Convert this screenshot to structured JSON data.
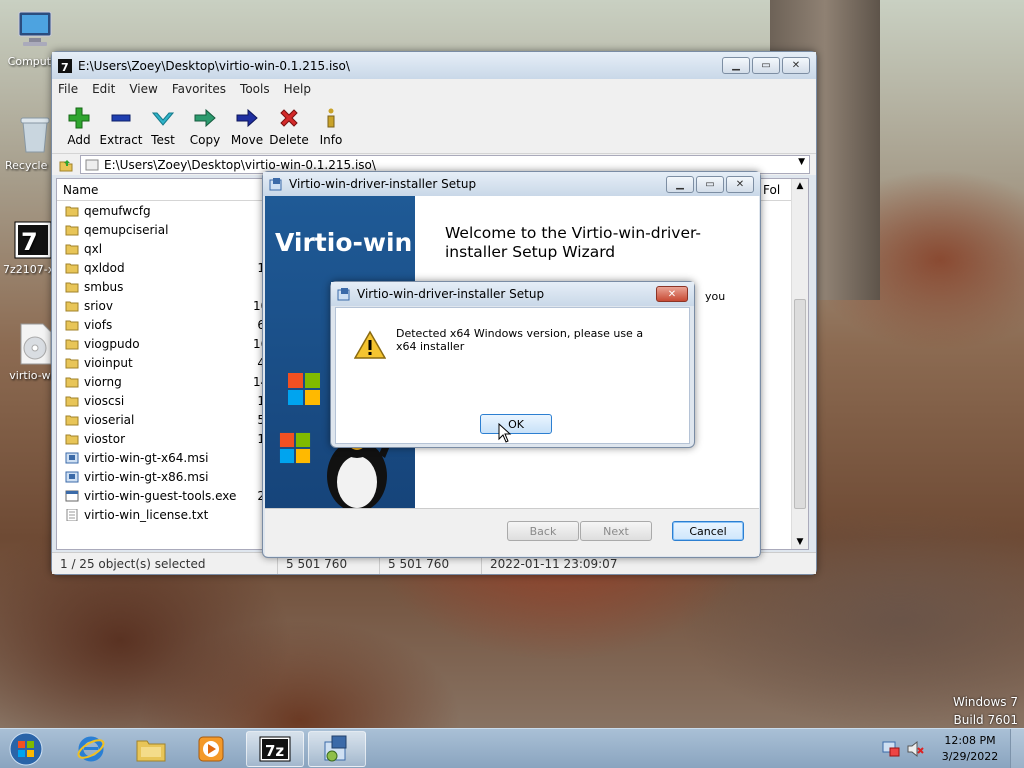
{
  "desktop": {
    "icons": [
      {
        "label": "Computer"
      },
      {
        "label": "Recycle Bin"
      },
      {
        "label": "7z2107-x64"
      },
      {
        "label": "virtio-win"
      }
    ],
    "watermark": {
      "line1": "Windows 7",
      "line2": "Build 7601"
    }
  },
  "sevenzip": {
    "title": "E:\\Users\\Zoey\\Desktop\\virtio-win-0.1.215.iso\\",
    "menu": [
      "File",
      "Edit",
      "View",
      "Favorites",
      "Tools",
      "Help"
    ],
    "toolbar": [
      {
        "label": "Add",
        "icon": "plus-icon",
        "color": "#2fa52f"
      },
      {
        "label": "Extract",
        "icon": "minus-icon",
        "color": "#1f3fb0"
      },
      {
        "label": "Test",
        "icon": "check-icon",
        "color": "#2fb3c9"
      },
      {
        "label": "Copy",
        "icon": "arrow-right-icon",
        "color": "#2c9a6e"
      },
      {
        "label": "Move",
        "icon": "arrow-right-icon",
        "color": "#1f2fa0"
      },
      {
        "label": "Delete",
        "icon": "x-icon",
        "color": "#d42a2a"
      },
      {
        "label": "Info",
        "icon": "info-icon",
        "color": "#c9a32a"
      }
    ],
    "address": "E:\\Users\\Zoey\\Desktop\\virtio-win-0.1.215.iso\\",
    "columns": {
      "name": "Name",
      "folders": "Fol"
    },
    "files": [
      {
        "name": "qemufwcfg",
        "type": "folder",
        "size": ""
      },
      {
        "name": "qemupciserial",
        "type": "folder",
        "size": ""
      },
      {
        "name": "qxl",
        "type": "folder",
        "size": ""
      },
      {
        "name": "qxldod",
        "type": "folder",
        "size": "1"
      },
      {
        "name": "smbus",
        "type": "folder",
        "size": ""
      },
      {
        "name": "sriov",
        "type": "folder",
        "size": "10"
      },
      {
        "name": "viofs",
        "type": "folder",
        "size": "6"
      },
      {
        "name": "viogpudo",
        "type": "folder",
        "size": "16"
      },
      {
        "name": "vioinput",
        "type": "folder",
        "size": "4"
      },
      {
        "name": "viorng",
        "type": "folder",
        "size": "14"
      },
      {
        "name": "vioscsi",
        "type": "folder",
        "size": "1"
      },
      {
        "name": "vioserial",
        "type": "folder",
        "size": "5"
      },
      {
        "name": "viostor",
        "type": "folder",
        "size": "1"
      },
      {
        "name": "virtio-win-gt-x64.msi",
        "type": "msi",
        "size": ""
      },
      {
        "name": "virtio-win-gt-x86.msi",
        "type": "msi",
        "size": ""
      },
      {
        "name": "virtio-win-guest-tools.exe",
        "type": "exe",
        "size": "2"
      },
      {
        "name": "virtio-win_license.txt",
        "type": "txt",
        "size": ""
      }
    ],
    "status": {
      "selected": "1 / 25 object(s) selected",
      "size": "5 501 760",
      "packed": "5 501 760",
      "modified": "2022-01-11 23:09:07"
    }
  },
  "setup": {
    "title": "Virtio-win-driver-installer Setup",
    "banner_brand": "Virtio-win",
    "welcome": "Welcome to the Virtio-win-driver-installer Setup Wizard",
    "partial_text": "you",
    "buttons": {
      "back": "Back",
      "next": "Next",
      "cancel": "Cancel"
    }
  },
  "msgbox": {
    "title": "Virtio-win-driver-installer Setup",
    "message": "Detected x64 Windows version, please use a x64 installer",
    "ok": "OK"
  },
  "taskbar": {
    "clock": {
      "time": "12:08 PM",
      "date": "3/29/2022"
    }
  }
}
